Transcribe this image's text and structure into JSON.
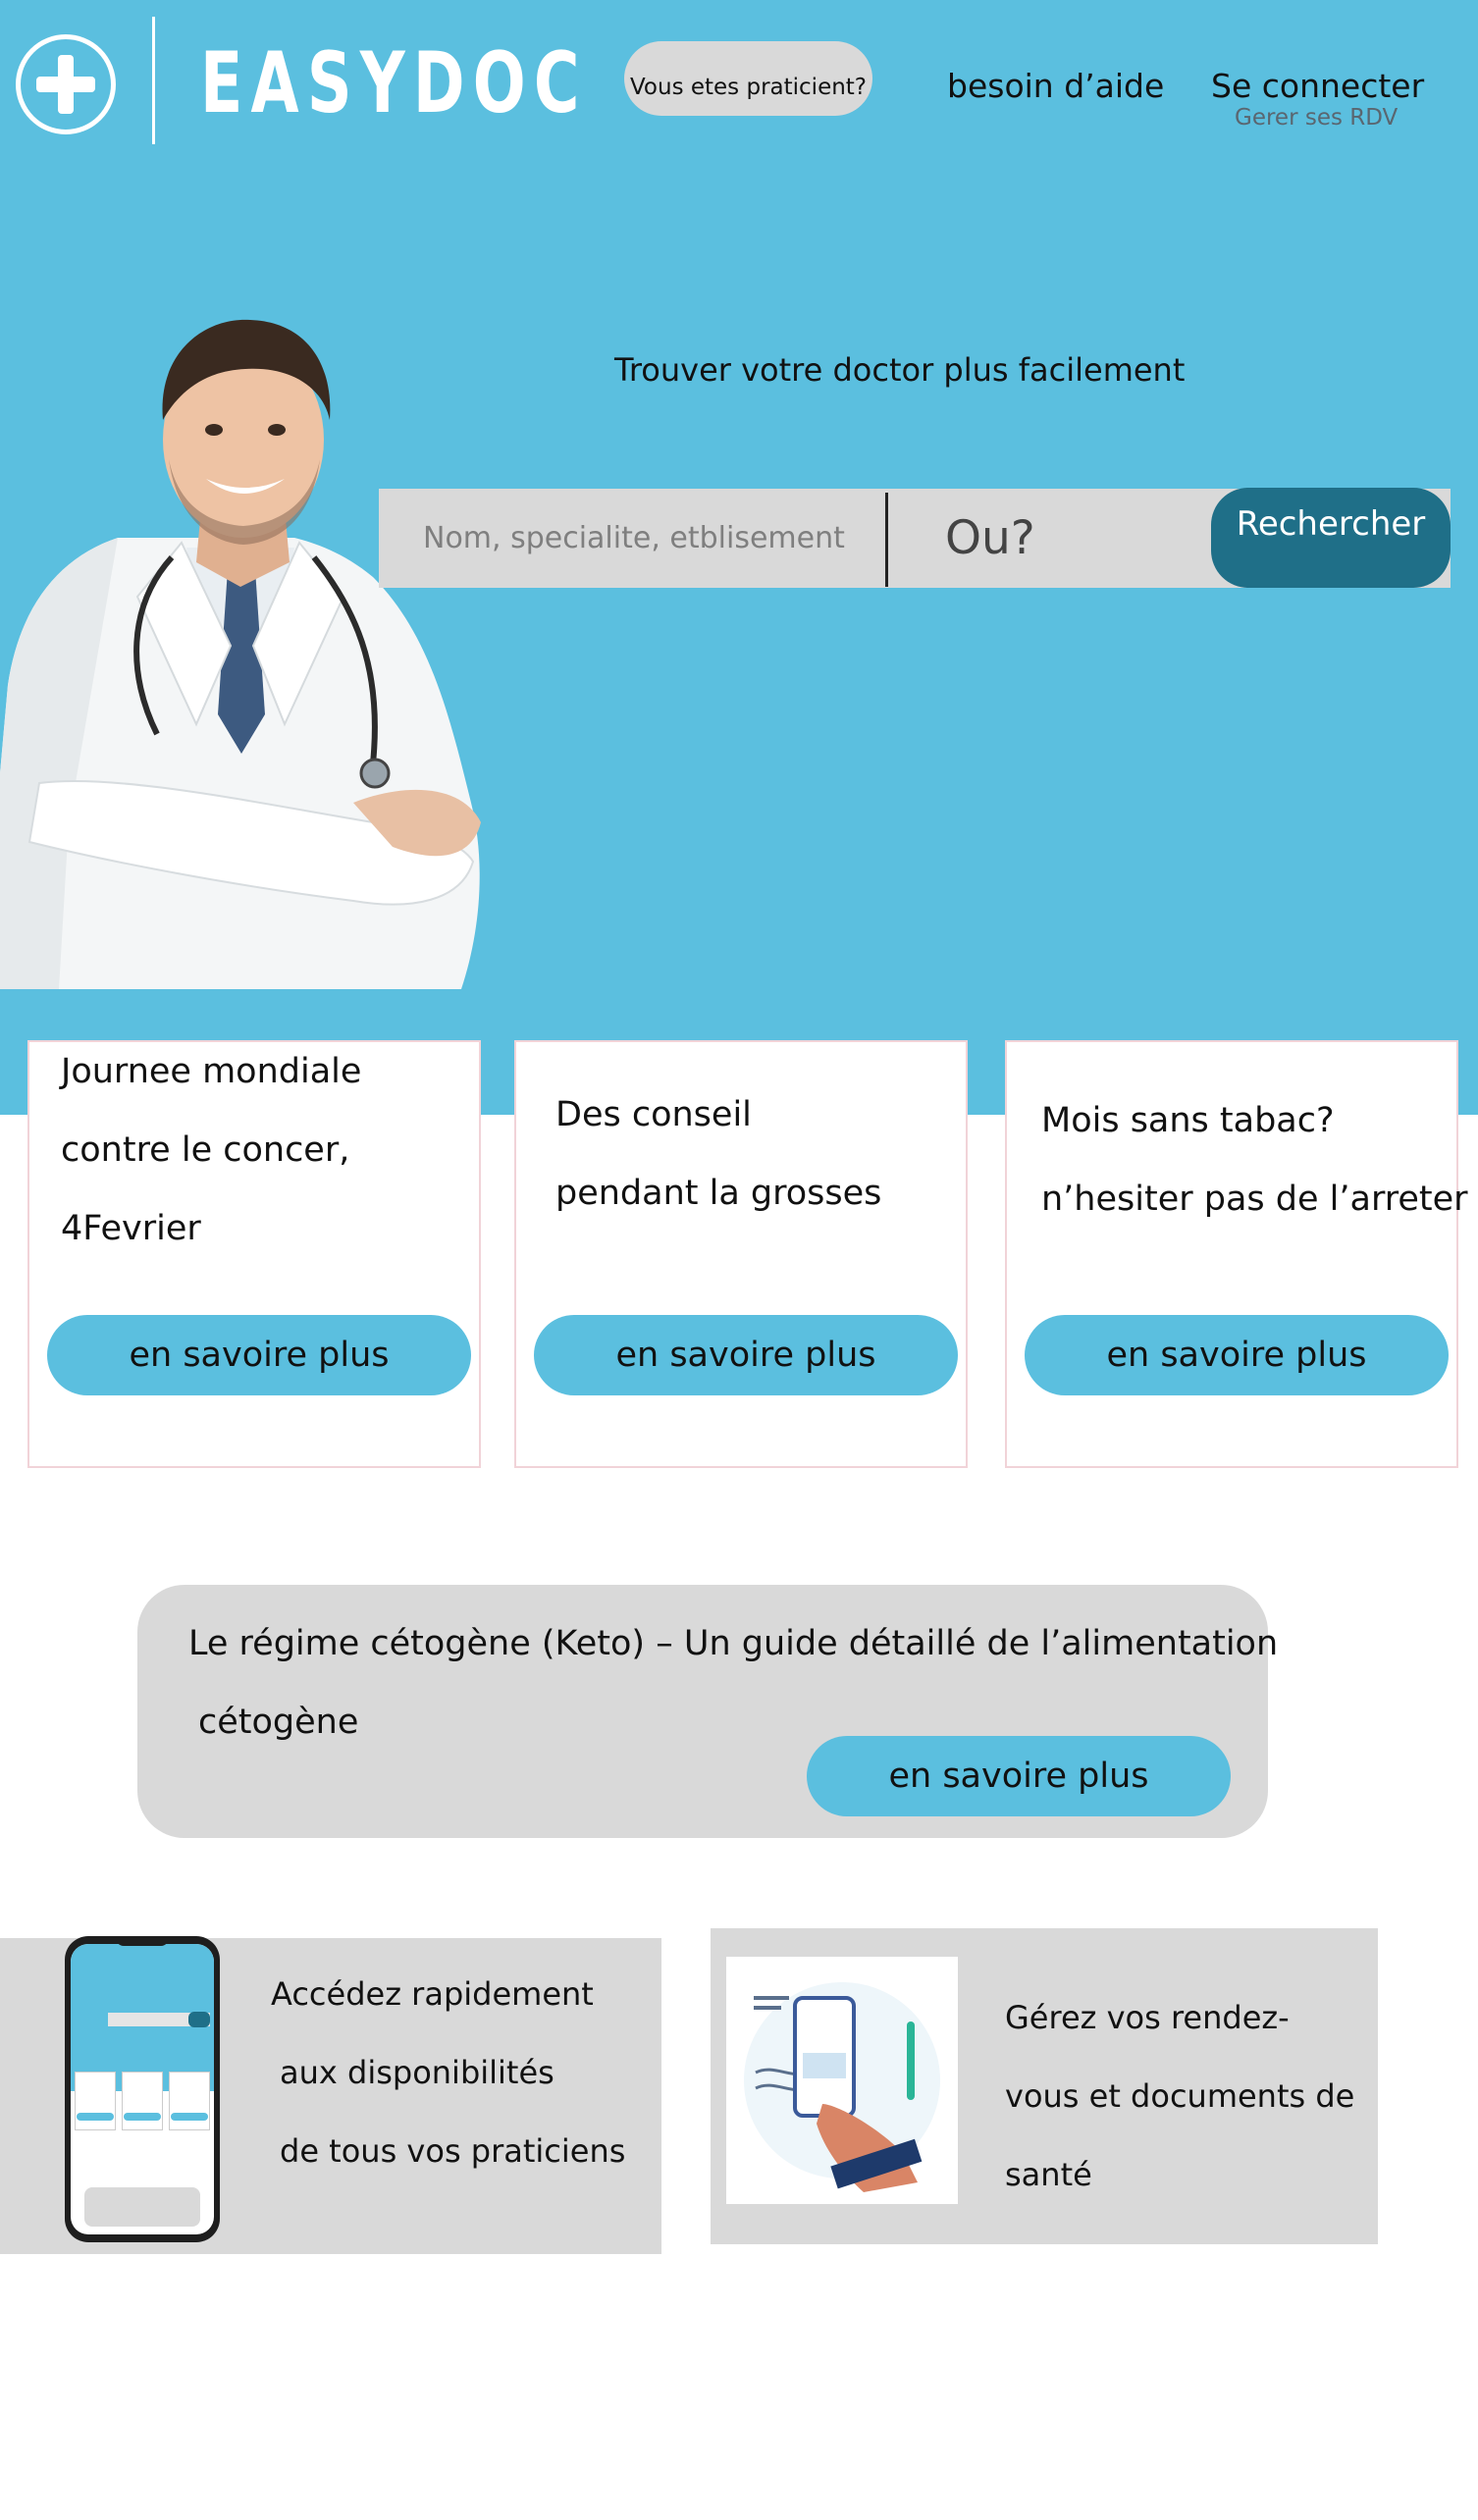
{
  "brand": {
    "name": "EASYDOC"
  },
  "header": {
    "pro_button": "Vous etes praticient?",
    "help_link": "besoin d’aide",
    "login_link": "Se connecter",
    "login_sub": "Gerer ses RDV"
  },
  "hero": {
    "tagline": "Trouver votre doctor plus facilement",
    "search_placeholder": "Nom, specialite, etblisement",
    "where_placeholder": "Ou?",
    "search_button": "Rechercher"
  },
  "cards": [
    {
      "lines": [
        "Journee mondiale",
        "contre le concer,",
        "4Fevrier"
      ],
      "button": "en savoire plus"
    },
    {
      "lines": [
        "Des conseil",
        "pendant la grosses"
      ],
      "button": "en savoire plus"
    },
    {
      "lines": [
        "Mois sans tabac?",
        "n’hesiter pas de l’arreter"
      ],
      "button": "en savoire plus"
    }
  ],
  "keto": {
    "line1": "Le régime cétogène (Keto) – Un guide détaillé de l’alimentation",
    "line2": "cétogène",
    "button": "en savoire plus"
  },
  "features": [
    {
      "lines": [
        "Accédez rapidement",
        "aux disponibilités",
        "de tous vos praticiens"
      ],
      "icon": "smartphone-app-preview"
    },
    {
      "lines": [
        "Gérez vos rendez-",
        "vous et documents de",
        "santé"
      ],
      "icon": "hand-holding-phone-illustration"
    }
  ],
  "colors": {
    "hero_bg": "#5bbfdf",
    "primary_button": "#1f6f88",
    "pill_button": "#5bbfdf",
    "panel_gray": "#d9d9d9"
  }
}
